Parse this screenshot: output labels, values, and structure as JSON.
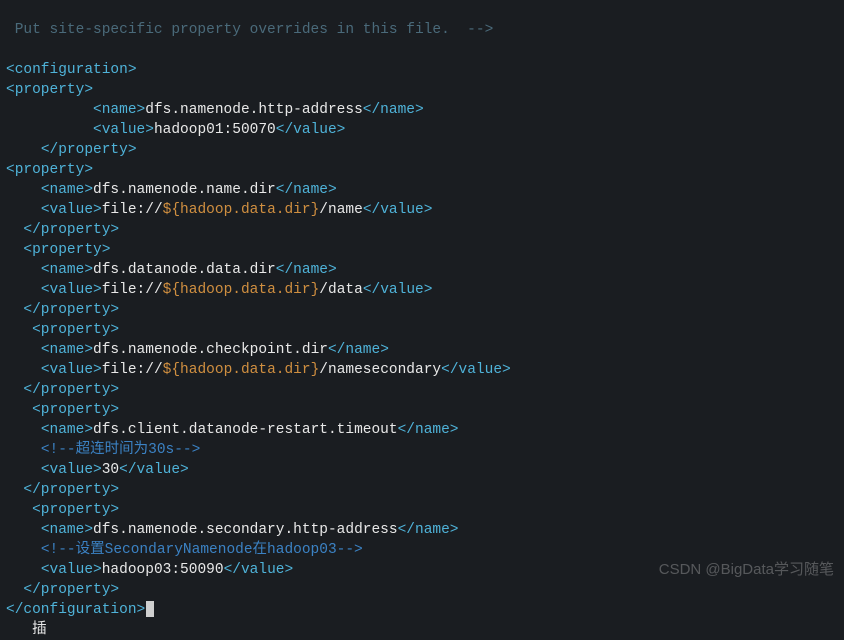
{
  "top_comment_partial": " Put site-specific property overrides in this file.  -->",
  "cfg_open": "<configuration>",
  "cfg_close": "</configuration>",
  "prop_open": "<property>",
  "prop_close": "</property>",
  "name_open": "<name>",
  "name_close": "</name>",
  "value_open": "<value>",
  "value_close": "</value>",
  "items": [
    {
      "name": "dfs.namenode.http-address",
      "value": "hadoop01:50070",
      "indent_name": "          ",
      "indent_value": "          ",
      "indent_close": "    "
    },
    {
      "name": "dfs.namenode.name.dir",
      "value_prefix": "file://",
      "value_var": "${hadoop.data.dir}",
      "value_suffix": "/name",
      "indent_open": "  ",
      "indent_name": "    ",
      "indent_value": "    ",
      "indent_close": "  "
    },
    {
      "name": "dfs.datanode.data.dir",
      "value_prefix": "file://",
      "value_var": "${hadoop.data.dir}",
      "value_suffix": "/data",
      "indent_open": "  ",
      "indent_name": "    ",
      "indent_value": "    ",
      "indent_close": "  "
    },
    {
      "name": "dfs.namenode.checkpoint.dir",
      "value_prefix": "file://",
      "value_var": "${hadoop.data.dir}",
      "value_suffix": "/namesecondary",
      "indent_open": "   ",
      "indent_name": "    ",
      "indent_value": "    ",
      "indent_close": "  "
    },
    {
      "name": "dfs.client.datanode-restart.timeout",
      "comment": "<!--超连时间为30s-->",
      "value": "30",
      "indent_open": "   ",
      "indent_name": "    ",
      "indent_comment": "    ",
      "indent_value": "    ",
      "indent_close": "  "
    },
    {
      "name": "dfs.namenode.secondary.http-address",
      "comment": "<!--设置SecondaryNamenode在hadoop03-->",
      "value": "hadoop03:50090",
      "indent_open": "   ",
      "indent_name": "    ",
      "indent_comment": "    ",
      "indent_value": "    ",
      "indent_close": "  "
    }
  ],
  "bottom_partial": "   插 ",
  "watermark": "CSDN @BigData学习随笔"
}
